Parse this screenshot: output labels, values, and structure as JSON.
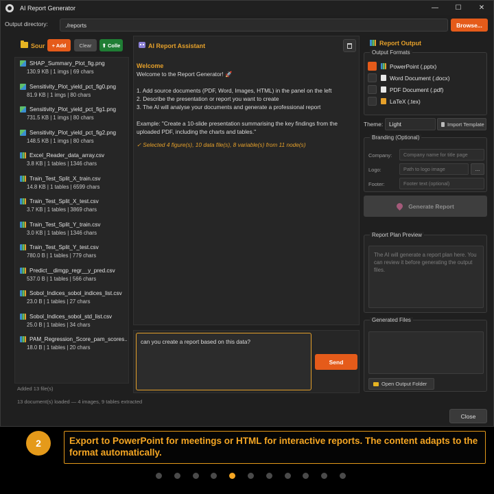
{
  "window": {
    "title": "AI Report Generator",
    "controls": [
      "—",
      "☐",
      "✕"
    ]
  },
  "output_dir": {
    "label": "Output directory:",
    "value": "./reports",
    "browse_label": "Browse..."
  },
  "sources": {
    "title": "Sour",
    "add_label": "+ Add",
    "clear_label": "Clear",
    "collect_label": "⬆ Colle",
    "files": [
      {
        "name": "SHAP_Summary_Plot_fig.png",
        "meta": "130.9 KB | 1 imgs | 69 chars",
        "type": "image"
      },
      {
        "name": "Sensitivity_Plot_yield_pct_fig0.png",
        "meta": "81.9 KB | 1 imgs | 80 chars",
        "type": "image"
      },
      {
        "name": "Sensitivity_Plot_yield_pct_fig1.png",
        "meta": "731.5 KB | 1 imgs | 80 chars",
        "type": "image"
      },
      {
        "name": "Sensitivity_Plot_yield_pct_fig2.png",
        "meta": "148.5 KB | 1 imgs | 80 chars",
        "type": "image"
      },
      {
        "name": "Excel_Reader_data_array.csv",
        "meta": "3.8 KB | 1 tables | 1346 chars",
        "type": "csv"
      },
      {
        "name": "Train_Test_Split_X_train.csv",
        "meta": "14.8 KB | 1 tables | 6599 chars",
        "type": "csv"
      },
      {
        "name": "Train_Test_Split_X_test.csv",
        "meta": "3.7 KB | 1 tables | 3869 chars",
        "type": "csv"
      },
      {
        "name": "Train_Test_Split_Y_train.csv",
        "meta": "3.0 KB | 1 tables | 1346 chars",
        "type": "csv"
      },
      {
        "name": "Train_Test_Split_Y_test.csv",
        "meta": "780.0 B | 1 tables | 779 chars",
        "type": "csv"
      },
      {
        "name": "Predict__dimgp_regr__y_pred.csv",
        "meta": "537.0 B | 1 tables | 566 chars",
        "type": "csv"
      },
      {
        "name": "Sobol_Indices_sobol_indices_list.csv",
        "meta": "23.0 B | 1 tables | 27 chars",
        "type": "csv"
      },
      {
        "name": "Sobol_Indices_sobol_std_list.csv",
        "meta": "25.0 B | 1 tables | 34 chars",
        "type": "csv"
      },
      {
        "name": "PAM_Regression_Score_pam_scores....",
        "meta": "18.0 B | 1 tables | 20 chars",
        "type": "csv"
      }
    ],
    "added_text": "Added 13 file(s)"
  },
  "assistant": {
    "title": "AI Report Assistant",
    "welcome_heading": "Welcome",
    "lines": [
      "Welcome to the Report Generator! 🚀",
      "",
      "1. Add source documents (PDF, Word, Images, HTML) in the panel on the left",
      "2. Describe the presentation or report you want to create",
      "3. The AI will analyse your documents and generate a professional report",
      "",
      "Example: \"Create a 10-slide presentation summarising the key findings from the",
      "uploaded PDF, including the charts and tables.\""
    ],
    "status": "✓ Selected 4 figure(s), 10 data file(s), 8 variable(s) from 11 node(s)",
    "input_value": "can you create a report based on this data?",
    "send_label": "Send"
  },
  "output": {
    "title": "Report Output",
    "formats_label": "Output Formats",
    "formats": [
      {
        "label": "PowerPoint (.pptx)",
        "checked": true,
        "icon": "ppt"
      },
      {
        "label": "Word Document (.docx)",
        "checked": false,
        "icon": "doc"
      },
      {
        "label": "PDF Document (.pdf)",
        "checked": false,
        "icon": "pdf"
      },
      {
        "label": "LaTeX (.tex)",
        "checked": false,
        "icon": "tex"
      }
    ],
    "theme_label": "Theme:",
    "theme_value": "Light",
    "import_template_label": "Import Template",
    "branding_label": "Branding (Optional)",
    "company_label": "Company:",
    "company_placeholder": "Company name for title page",
    "logo_label": "Logo:",
    "logo_placeholder": "Path to logo image",
    "logo_browse_label": "...",
    "footer_label": "Footer:",
    "footer_placeholder": "Footer text (optional)",
    "generate_label": "Generate Report",
    "plan_label": "Report Plan Preview",
    "plan_text": "The AI will generate a report plan here. You can review it before generating the output files.",
    "generated_label": "Generated Files",
    "open_folder_label": "Open Output Folder"
  },
  "status_text": "13 document(s) loaded — 4 images, 9 tables extracted",
  "close_label": "Close",
  "caption": {
    "step": "2",
    "text": "Export to PowerPoint for meetings or HTML for interactive reports. The content adapts to the format automatically."
  },
  "pagination": {
    "total": 11,
    "active_index": 4
  },
  "colors": {
    "accent": "#e55b1a",
    "heading": "#e5a02a",
    "caption": "#f5a623"
  }
}
